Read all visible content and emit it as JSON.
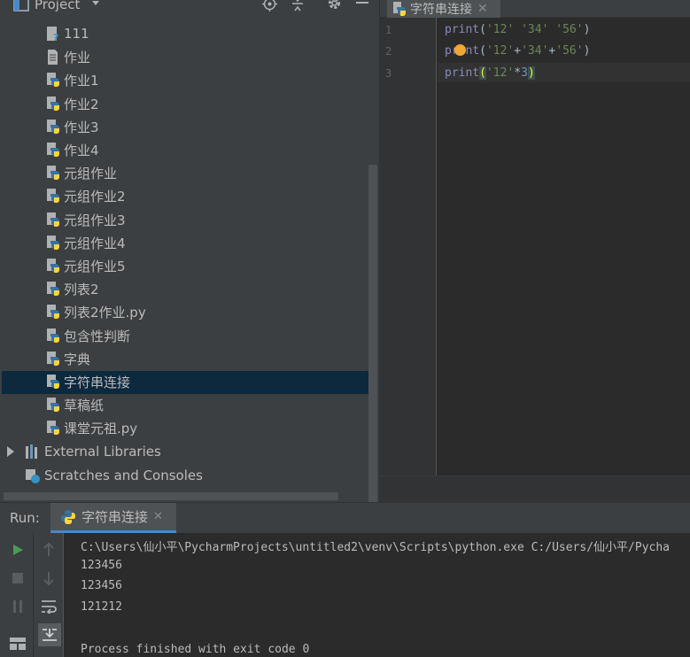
{
  "project": {
    "title": "Project",
    "tree_items": [
      {
        "label": "111",
        "icon": "unknown-file-icon"
      },
      {
        "label": "作业",
        "icon": "text-file-icon"
      },
      {
        "label": "作业1",
        "icon": "python-file-icon"
      },
      {
        "label": "作业2",
        "icon": "python-file-icon"
      },
      {
        "label": "作业3",
        "icon": "python-file-icon"
      },
      {
        "label": "作业4",
        "icon": "python-file-icon"
      },
      {
        "label": "元组作业",
        "icon": "python-file-icon"
      },
      {
        "label": "元组作业2",
        "icon": "python-file-icon"
      },
      {
        "label": "元组作业3",
        "icon": "python-file-icon"
      },
      {
        "label": "元组作业4",
        "icon": "python-file-icon"
      },
      {
        "label": "元组作业5",
        "icon": "python-file-icon"
      },
      {
        "label": "列表2",
        "icon": "python-file-icon"
      },
      {
        "label": "列表2作业.py",
        "icon": "python-file-icon"
      },
      {
        "label": "包含性判断",
        "icon": "python-file-icon"
      },
      {
        "label": "字典",
        "icon": "python-file-icon"
      },
      {
        "label": "字符串连接",
        "icon": "python-file-icon",
        "selected": true
      },
      {
        "label": "草稿纸",
        "icon": "python-file-icon"
      },
      {
        "label": "课堂元祖.py",
        "icon": "python-file-icon"
      }
    ],
    "external_libraries": "External Libraries",
    "scratches": "Scratches and Consoles"
  },
  "editor": {
    "tab_label": "字符串连接",
    "line_numbers": [
      "1",
      "2",
      "3"
    ],
    "lines": {
      "l1": {
        "fn": "print",
        "open": "(",
        "s1": "'12'",
        "sp1": " ",
        "s2": "'34'",
        "sp2": " ",
        "s3": "'56'",
        "close": ")"
      },
      "l2": {
        "fn": "print",
        "open": "(",
        "s1": "'12'",
        "op1": "+",
        "s2": "'34'",
        "op2": "+",
        "s3": "'56'",
        "close": ")"
      },
      "l3": {
        "fn": "print",
        "open": "(",
        "s1": "'12'",
        "op": "*",
        "n": "3",
        "close": ")"
      }
    }
  },
  "run": {
    "label": "Run:",
    "tab_label": "字符串连接",
    "output": [
      "C:\\Users\\仙小平\\PycharmProjects\\untitled2\\venv\\Scripts\\python.exe C:/Users/仙小平/Pycha",
      "123456",
      "123456",
      "121212",
      "",
      "Process finished with exit code 0"
    ]
  },
  "colors": {
    "panel_bg": "#3c3f41",
    "editor_bg": "#2b2b2b",
    "selection": "#0d293e",
    "accent": "#4a88c7",
    "run_green": "#499c54"
  }
}
